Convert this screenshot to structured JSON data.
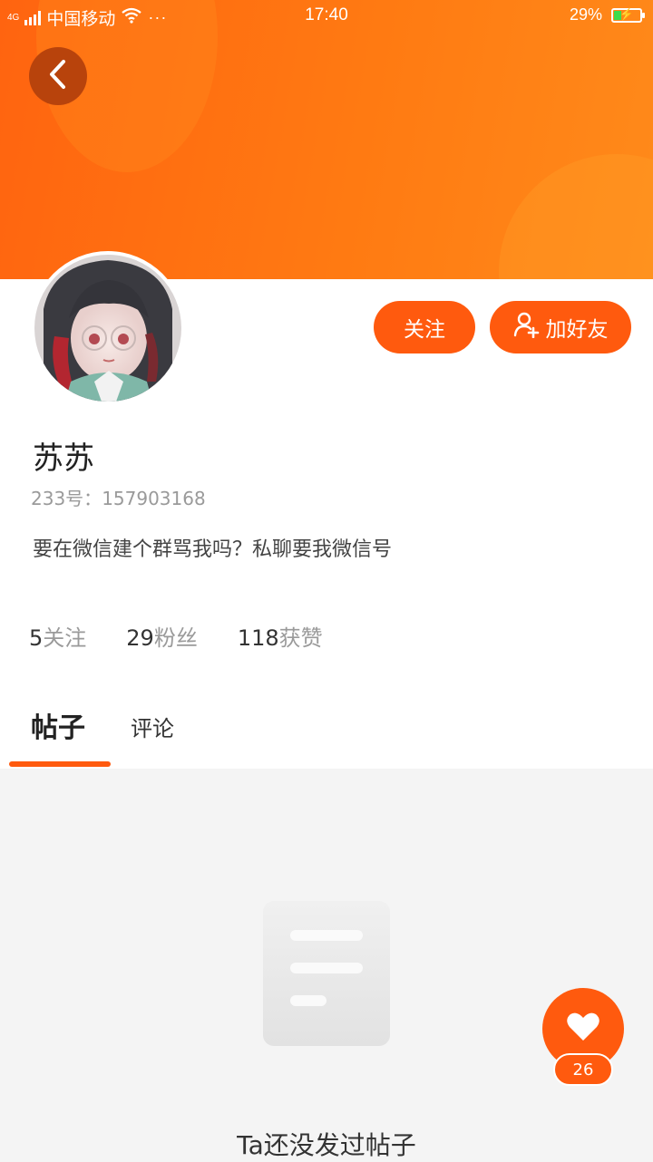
{
  "status_bar": {
    "network": "4G",
    "carrier": "中国移动",
    "dots": "···",
    "time": "17:40",
    "battery": "29%",
    "battery_level": 0.29,
    "icons": [
      "signal-icon",
      "wifi-icon",
      "battery-charging-icon"
    ]
  },
  "header": {
    "back_icon": "chevron-left-icon"
  },
  "profile": {
    "name": "苏苏",
    "uid_label": "233号：",
    "uid": "157903168",
    "bio": "要在微信建个群骂我吗？私聊要我微信号",
    "follow_label": "关注",
    "add_friend_label": "加好友",
    "add_friend_icon": "add-user-icon"
  },
  "stats": [
    {
      "num": "5",
      "label": "关注"
    },
    {
      "num": "29",
      "label": "粉丝"
    },
    {
      "num": "118",
      "label": "获赞"
    }
  ],
  "tabs": [
    {
      "label": "帖子",
      "active": true
    },
    {
      "label": "评论",
      "active": false
    }
  ],
  "empty_state": {
    "text": "Ta还没发过帖子",
    "icon": "document-icon"
  },
  "like_fab": {
    "icon": "heart-icon",
    "count": "26"
  },
  "colors": {
    "accent": "#ff5a0e",
    "header_gradient_start": "#ff6410",
    "header_gradient_end": "#ff8a1a",
    "page_bg": "#f4f4f4"
  }
}
